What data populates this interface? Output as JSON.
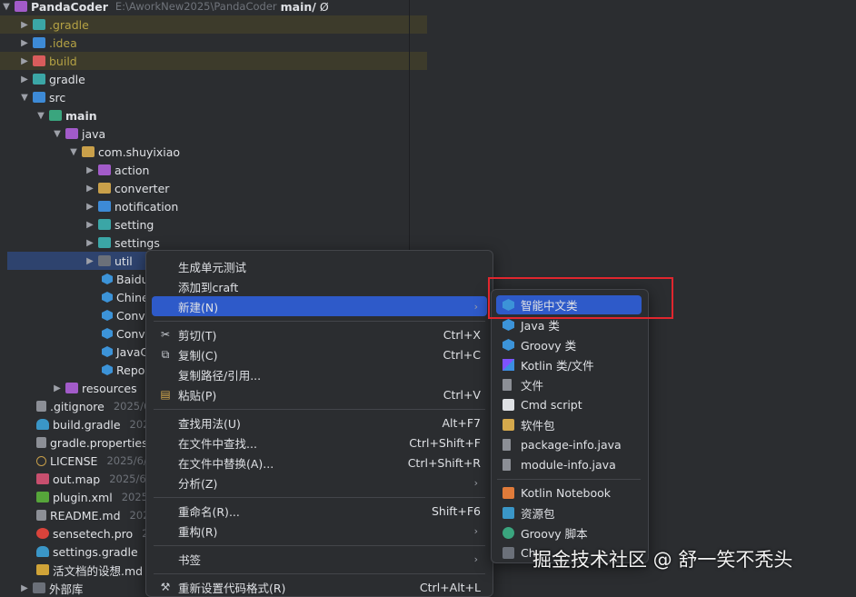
{
  "project": {
    "name": "PandaCoder",
    "path": "E:\\AworkNew2025\\PandaCoder",
    "branch": "main/",
    "branch_suffix": "Ø"
  },
  "tree": [
    {
      "label": ".gradle",
      "icon": "folder-icon"
    },
    {
      "label": ".idea",
      "icon": "folder-icon"
    },
    {
      "label": "build",
      "icon": "folder-icon"
    },
    {
      "label": "gradle",
      "icon": "folder-icon"
    },
    {
      "label": "src",
      "icon": "folder-icon"
    },
    {
      "label": "main",
      "icon": "folder-icon"
    },
    {
      "label": "java",
      "icon": "folder-icon"
    },
    {
      "label": "com.shuyixiao",
      "icon": "package-icon"
    },
    {
      "label": "action",
      "icon": "package-icon"
    },
    {
      "label": "converter",
      "icon": "package-icon"
    },
    {
      "label": "notification",
      "icon": "package-icon"
    },
    {
      "label": "setting",
      "icon": "package-icon"
    },
    {
      "label": "settings",
      "icon": "package-icon"
    },
    {
      "label": "util",
      "icon": "package-icon"
    },
    {
      "label": "Baidu",
      "icon": "class-icon"
    },
    {
      "label": "Chine",
      "icon": "class-icon"
    },
    {
      "label": "Conve",
      "icon": "class-icon"
    },
    {
      "label": "Conve",
      "icon": "class-icon"
    },
    {
      "label": "JavaC",
      "icon": "class-icon"
    },
    {
      "label": "Repo",
      "icon": "class-icon"
    },
    {
      "label": "resources",
      "icon": "folder-icon"
    },
    {
      "label": ".gitignore",
      "date": "2025/6/",
      "icon": "file-icon"
    },
    {
      "label": "build.gradle",
      "date": "2025",
      "icon": "gradle-icon"
    },
    {
      "label": "gradle.properties",
      "icon": "file-icon"
    },
    {
      "label": "LICENSE",
      "date": "2025/6/3",
      "icon": "file-icon"
    },
    {
      "label": "out.map",
      "date": "2025/6/3",
      "icon": "file-icon"
    },
    {
      "label": "plugin.xml",
      "date": "2025/6/",
      "icon": "file-icon"
    },
    {
      "label": "README.md",
      "date": "2025",
      "icon": "file-icon"
    },
    {
      "label": "sensetech.pro",
      "date": "202",
      "icon": "file-icon"
    },
    {
      "label": "settings.gradle",
      "date": "20",
      "icon": "gradle-icon"
    },
    {
      "label": "活文档的设想.md",
      "icon": "file-icon"
    },
    {
      "label": "外部库",
      "icon": "folder-icon"
    }
  ],
  "context_menu": {
    "items": [
      {
        "label": "生成单元测试"
      },
      {
        "label": "添加到craft"
      },
      {
        "label": "新建(N)",
        "submenu": true
      },
      {
        "label": "剪切(T)",
        "shortcut": "Ctrl+X",
        "icon": "scissors-icon"
      },
      {
        "label": "复制(C)",
        "shortcut": "Ctrl+C",
        "icon": "copy-icon"
      },
      {
        "label": "复制路径/引用..."
      },
      {
        "label": "粘贴(P)",
        "shortcut": "Ctrl+V",
        "icon": "paste-icon"
      },
      {
        "label": "查找用法(U)",
        "shortcut": "Alt+F7"
      },
      {
        "label": "在文件中查找...",
        "shortcut": "Ctrl+Shift+F"
      },
      {
        "label": "在文件中替换(A)...",
        "shortcut": "Ctrl+Shift+R"
      },
      {
        "label": "分析(Z)",
        "submenu": true
      },
      {
        "label": "重命名(R)...",
        "shortcut": "Shift+F6"
      },
      {
        "label": "重构(R)",
        "submenu": true
      },
      {
        "label": "书签",
        "submenu": true
      },
      {
        "label": "重新设置代码格式(R)",
        "shortcut": "Ctrl+Alt+L",
        "icon": "format-icon"
      }
    ]
  },
  "submenu": {
    "items": [
      {
        "label": "智能中文类",
        "icon": "class-icon"
      },
      {
        "label": "Java 类",
        "icon": "java-class-icon"
      },
      {
        "label": "Groovy 类",
        "icon": "groovy-class-icon"
      },
      {
        "label": "Kotlin 类/文件",
        "icon": "kotlin-icon"
      },
      {
        "label": "文件",
        "icon": "file-icon"
      },
      {
        "label": "Cmd script",
        "icon": "cmd-icon"
      },
      {
        "label": "软件包",
        "icon": "package-icon"
      },
      {
        "label": "package-info.java",
        "icon": "java-file-icon"
      },
      {
        "label": "module-info.java",
        "icon": "java-file-icon"
      },
      {
        "label": "Kotlin Notebook",
        "icon": "notebook-icon"
      },
      {
        "label": "资源包",
        "icon": "resource-bundle-icon"
      },
      {
        "label": "Groovy 脚本",
        "icon": "groovy-script-icon"
      },
      {
        "label": "Ch",
        "icon": "chart-icon"
      }
    ]
  },
  "watermark": "掘金技术社区 @ 舒一笑不秃头"
}
